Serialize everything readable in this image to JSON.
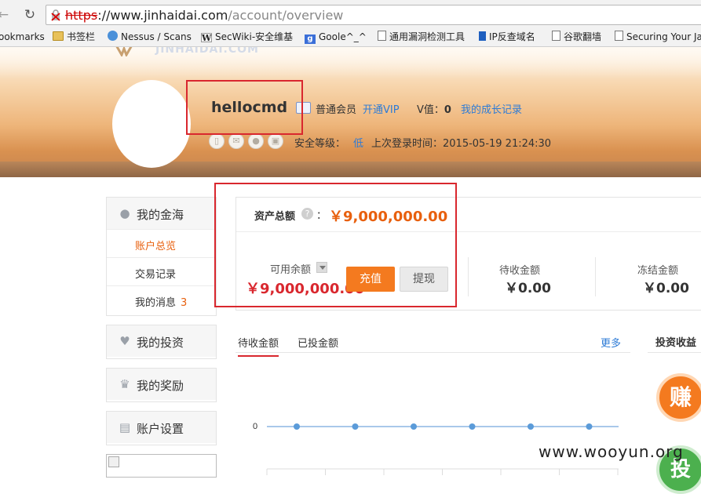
{
  "browser": {
    "url_scheme": "https",
    "url_host": "://www.jinhaidai.com",
    "url_path": "/account/overview",
    "bookmarks": [
      {
        "label": "ookmarks",
        "icon": "none"
      },
      {
        "label": "书签栏",
        "icon": "folder-icon"
      },
      {
        "label": "Nessus / Scans",
        "icon": "nessus-icon"
      },
      {
        "label": "SecWiki-安全维基",
        "icon": "wiki-icon"
      },
      {
        "label": "Goole^_^",
        "icon": "google-icon"
      },
      {
        "label": "通用漏洞检测工具",
        "icon": "page-icon"
      },
      {
        "label": "IP反查域名",
        "icon": "ip-icon"
      },
      {
        "label": "谷歌翻墙",
        "icon": "page-icon"
      },
      {
        "label": "Securing Your Ja",
        "icon": "page-icon"
      }
    ]
  },
  "header": {
    "logo_text": "JINHAIDAI.COM",
    "username": "hellocmd",
    "member_label": "普通会员",
    "vip_link": "开通VIP",
    "v_label": "V值：",
    "v_value": "0",
    "growth_link": "我的成长记录",
    "security_label": "安全等级：",
    "security_level": "低",
    "last_login": "上次登录时间：2015-05-19 21:24:30",
    "security_icons": [
      "phone-icon",
      "mail-icon",
      "user-icon",
      "lock-icon"
    ]
  },
  "sidebar": {
    "sections": [
      {
        "title": "我的金海",
        "icon": "user-icon",
        "items": [
          {
            "label": "账户总览",
            "active": true
          },
          {
            "label": "交易记录"
          },
          {
            "label": "我的消息",
            "badge": "3"
          }
        ]
      },
      {
        "title": "我的投资",
        "icon": "piggy-bank-icon",
        "items": []
      },
      {
        "title": "我的奖励",
        "icon": "trophy-icon",
        "items": []
      },
      {
        "title": "账户设置",
        "icon": "id-card-icon",
        "items": []
      }
    ]
  },
  "assets": {
    "total_label": "资产总额",
    "help": "?",
    "colon": "：",
    "total_value": "￥9,000,000.00",
    "available_label": "可用余额",
    "available_value": "￥9,000,000.00",
    "recharge": "充值",
    "withdraw": "提现",
    "pending_label": "待收金额",
    "pending_value": "￥0.00",
    "frozen_label": "冻结金额",
    "frozen_value": "￥0.00"
  },
  "tabs": {
    "pending": "待收金额",
    "invested": "已投金额",
    "more": "更多",
    "earnings_title": "投资收益",
    "earn_badge": "赚",
    "invest_badge": "投"
  },
  "chart_data": {
    "type": "line",
    "y_tick": "0",
    "values": [
      0,
      0,
      0,
      0,
      0,
      0
    ]
  },
  "watermark": "www.wooyun.org",
  "colors": {
    "accent": "#f47a1f",
    "highlight_box": "#d9272e",
    "link": "#2d7bd6"
  }
}
